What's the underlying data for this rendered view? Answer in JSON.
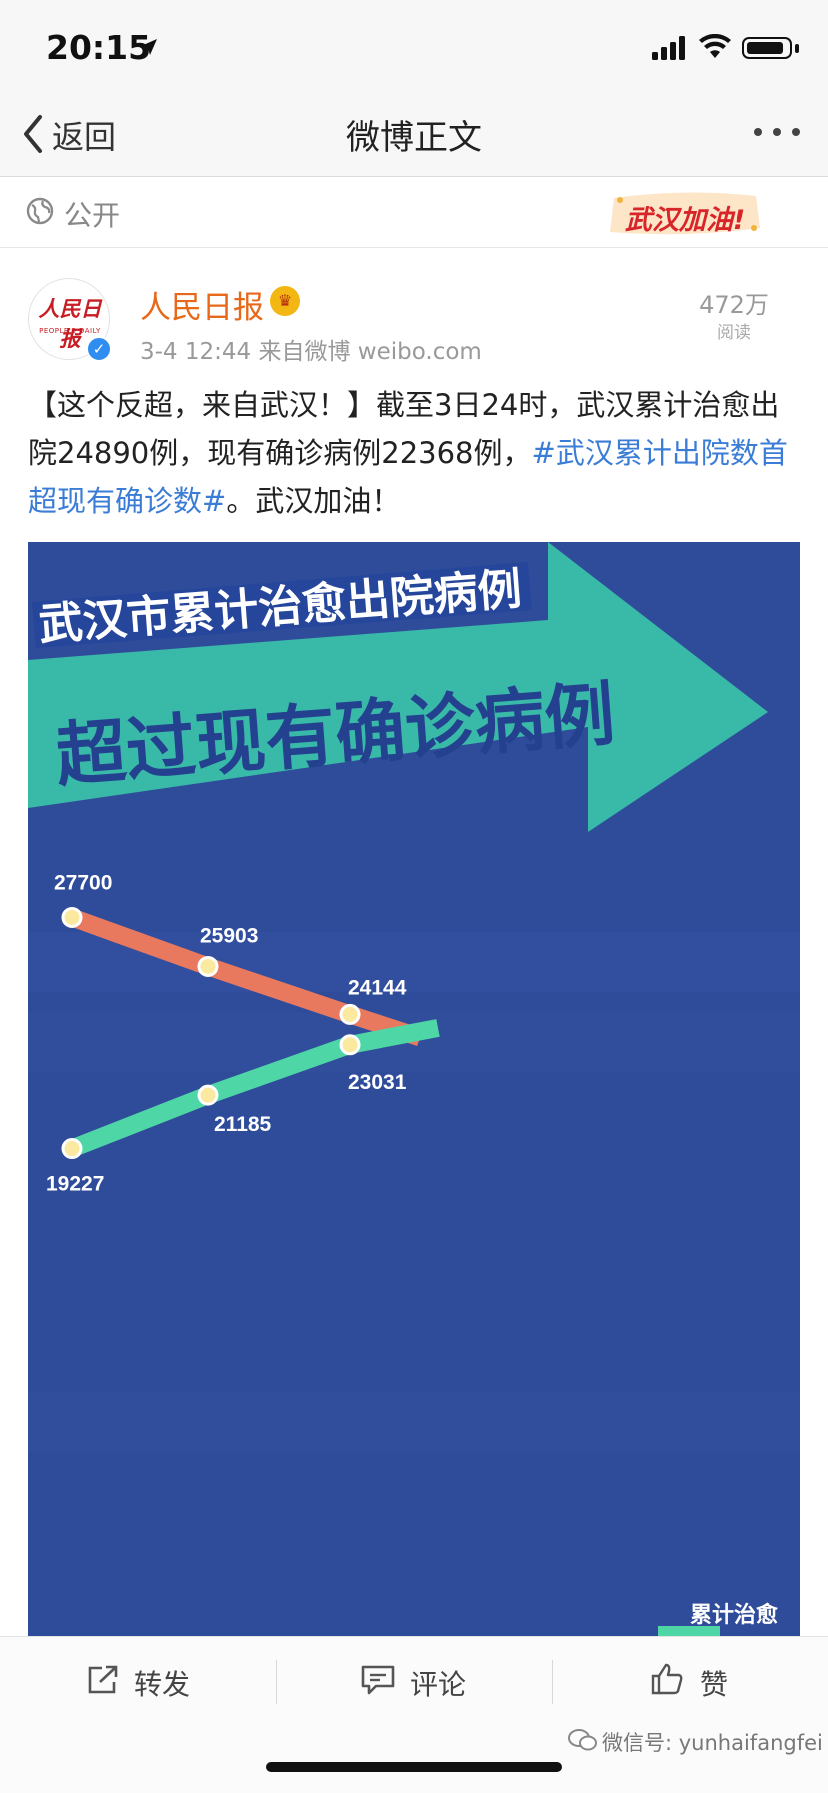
{
  "status": {
    "time": "20:15"
  },
  "nav": {
    "back_label": "返回",
    "title": "微博正文"
  },
  "visibility": {
    "label": "公开",
    "badge": "武汉加油!"
  },
  "author": {
    "name": "人民日报",
    "avatar_text": "人民日报",
    "avatar_subtext": "PEOPLE'S DAILY",
    "meta": "3-4 12:44  来自微博 weibo.com",
    "reads_count": "472万",
    "reads_label": "阅读"
  },
  "post": {
    "text_before": "【这个反超，来自武汉！】截至3日24时，武汉累计治愈出院24890例，现有确诊病例22368例，",
    "hashtag": "#武汉累计出院数首超现有确诊数#",
    "text_after": "。武汉加油！"
  },
  "infographic": {
    "headline_1": "武汉市累计治愈出院病例",
    "headline_2": "超过现有确诊病例",
    "legend_partial": "累计治愈"
  },
  "chart_data": {
    "type": "line",
    "x": [
      1,
      2,
      3,
      4
    ],
    "series": [
      {
        "name": "",
        "color": "#e8795f",
        "values": [
          27700,
          25903,
          24144
        ],
        "labels": [
          "27700",
          "25903",
          "24144"
        ]
      },
      {
        "name": "",
        "color": "#4fd6a6",
        "values": [
          19227,
          21185,
          23031
        ],
        "labels": [
          "19227",
          "21185",
          "23031"
        ]
      }
    ],
    "xlabel": "",
    "ylabel": "",
    "grid": false
  },
  "actions": {
    "repost": "转发",
    "comment": "评论",
    "like": "赞"
  },
  "watermark": "微信号: yunhaifangfei",
  "colors": {
    "accent_orange": "#e8681a",
    "link_blue": "#3b7dd6",
    "info_bg": "#2f4c9a",
    "teal": "#39b9a8"
  }
}
